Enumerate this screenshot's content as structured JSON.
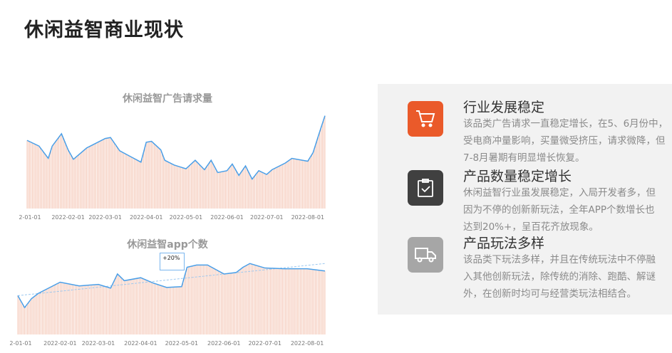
{
  "page_title": "休闲益智商业现状",
  "chart_data": [
    {
      "type": "line+bar",
      "title": "休闲益智广告请求量",
      "xlabel": "",
      "ylabel": "",
      "ylim": [
        0,
        100
      ],
      "x_ticks": [
        "2-01-01",
        "2022-02-01",
        "2022-03-01",
        "2022-04-01",
        "2022-05-01",
        "2022-06-01",
        "2022-07-01",
        "2022-08-01"
      ],
      "x_days": [
        0,
        9,
        16,
        19,
        26,
        31,
        35,
        45,
        59,
        63,
        70,
        78,
        86,
        90,
        94,
        101,
        104,
        111,
        120,
        127,
        134,
        139,
        144,
        151,
        155,
        160,
        165,
        170,
        175,
        181,
        185,
        195,
        200,
        212,
        216,
        221,
        225
      ],
      "values": [
        72,
        66,
        53,
        66,
        79,
        62,
        52,
        64,
        74,
        75,
        61,
        55,
        49,
        70,
        71,
        62,
        51,
        46,
        42,
        51,
        41,
        51,
        38,
        40,
        47,
        35,
        45,
        31,
        40,
        36,
        41,
        48,
        53,
        50,
        59,
        81,
        98
      ],
      "colors": {
        "line": "#4a9fe8",
        "bar": "#f2b9a4"
      }
    },
    {
      "type": "line+bar",
      "title": "休闲益智app个数",
      "annotation": "+20%",
      "xlabel": "",
      "ylabel": "",
      "ylim": [
        0,
        100
      ],
      "x_ticks": [
        "2-01-01",
        "2022-02-01",
        "2022-03-01",
        "2022-04-01",
        "2022-05-01",
        "2022-06-01",
        "2022-07-01",
        "2022-08-01"
      ],
      "x_days": [
        0,
        5,
        10,
        15,
        31,
        45,
        59,
        68,
        73,
        78,
        90,
        99,
        109,
        120,
        124,
        131,
        139,
        151,
        160,
        165,
        170,
        181,
        195,
        212,
        225
      ],
      "values": [
        52,
        36,
        48,
        55,
        70,
        65,
        67,
        62,
        81,
        72,
        76,
        69,
        63,
        64,
        90,
        93,
        93,
        81,
        83,
        90,
        95,
        89,
        88,
        88,
        85
      ],
      "trend": [
        52,
        95
      ],
      "colors": {
        "line": "#4a9fe8",
        "bar": "#f2b9a4",
        "trend": "#9cc8f0"
      }
    }
  ],
  "items": [
    {
      "icon": "cart-icon",
      "color": "#ea5a2a",
      "heading": "行业发展稳定",
      "lines": [
        "该品类广告请求一直稳定增长，在5、6月份中，",
        "受电商冲量影响，买量微受挤压，请求微降，但",
        "7-8月暑期有明显增长恢复。"
      ]
    },
    {
      "icon": "clipboard-check-icon",
      "color": "#404040",
      "heading": "产品数量稳定增长",
      "lines": [
        "休闲益智行业虽发展稳定，入局开发者多，但",
        "因为不停的创新新玩法，全年APP个数增长也",
        "达到20%+，呈百花齐放现象。"
      ]
    },
    {
      "icon": "truck-icon",
      "color": "#a6a6a6",
      "heading": "产品玩法多样",
      "lines": [
        "该品类下玩法多样，并且在传统玩法中不停融",
        "入其他创新玩法，除传统的消除、跑酷、解谜",
        "外，在创新时均可与经营类玩法相结合。"
      ]
    }
  ]
}
